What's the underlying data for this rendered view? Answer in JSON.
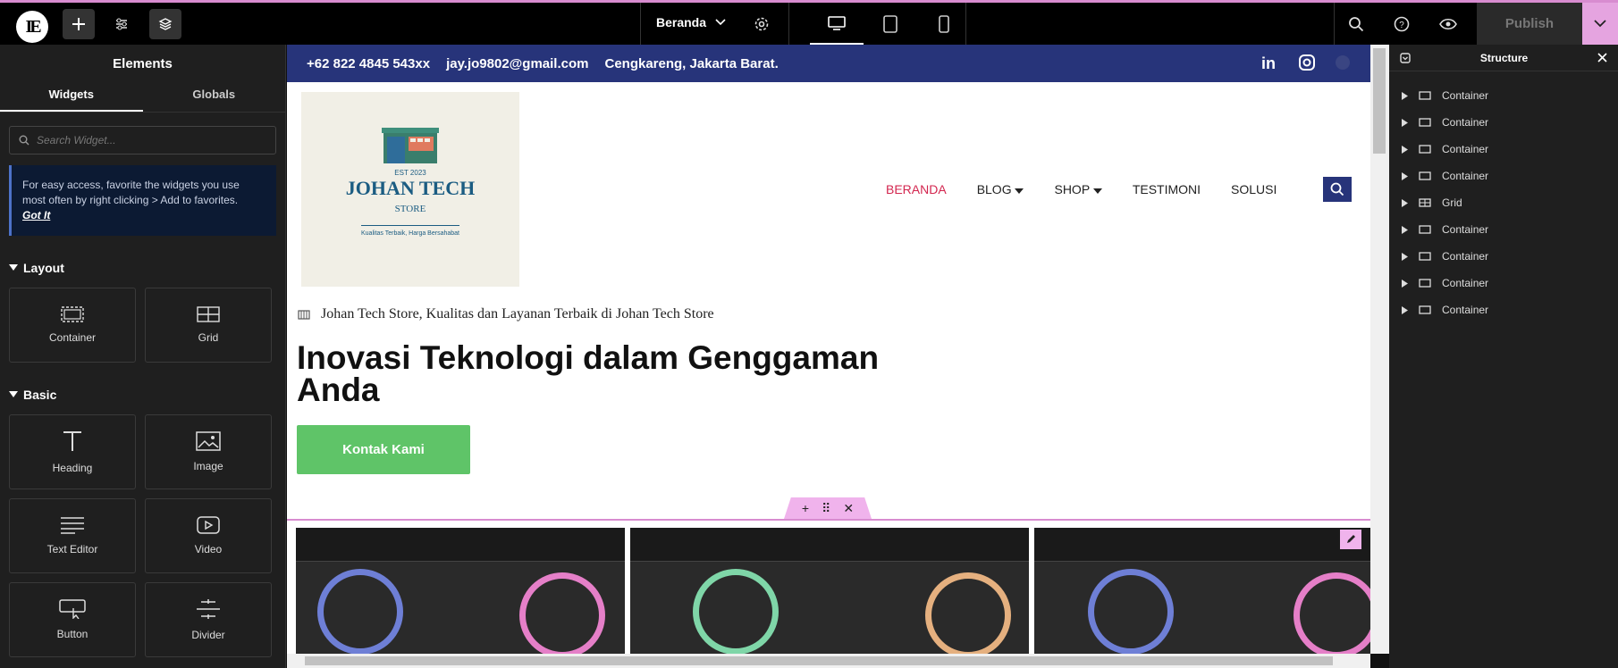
{
  "toolbar": {
    "page_name": "Beranda",
    "publish_label": "Publish"
  },
  "left_panel": {
    "title": "Elements",
    "tabs": [
      "Widgets",
      "Globals"
    ],
    "search_placeholder": "Search Widget...",
    "tip_text": "For easy access, favorite the widgets you use most often by right clicking > Add to favorites.",
    "tip_link": "Got It",
    "categories": [
      {
        "label": "Layout",
        "widgets": [
          {
            "label": "Container",
            "icon": "container-icon"
          },
          {
            "label": "Grid",
            "icon": "grid-icon"
          }
        ]
      },
      {
        "label": "Basic",
        "widgets": [
          {
            "label": "Heading",
            "icon": "heading-icon"
          },
          {
            "label": "Image",
            "icon": "image-icon"
          },
          {
            "label": "Text Editor",
            "icon": "text-editor-icon"
          },
          {
            "label": "Video",
            "icon": "video-icon"
          },
          {
            "label": "Button",
            "icon": "button-icon"
          },
          {
            "label": "Divider",
            "icon": "divider-icon"
          }
        ]
      }
    ]
  },
  "site": {
    "phone": "+62 822 4845 543xx",
    "email": "jay.jo9802@gmail.com",
    "address": "Cengkareng, Jakarta Barat.",
    "logo": {
      "est": "EST 2023",
      "name": "JOHAN TECH",
      "sub": "STORE",
      "small": "Kualitas Terbaik, Harga Bersahabat"
    },
    "nav": [
      "BERANDA",
      "BLOG",
      "SHOP",
      "TESTIMONI",
      "SOLUSI"
    ],
    "tagline": "Johan Tech Store, Kualitas dan Layanan Terbaik di Johan Tech Store",
    "hero_title": "Inovasi Teknologi dalam Genggaman Anda",
    "cta_label": "Kontak Kami",
    "brand_color": "#27347a",
    "accent_color": "#d3264f",
    "cta_color": "#5fc468"
  },
  "structure_panel": {
    "title": "Structure",
    "items": [
      "Container",
      "Container",
      "Container",
      "Container",
      "Grid",
      "Container",
      "Container",
      "Container",
      "Container"
    ]
  }
}
